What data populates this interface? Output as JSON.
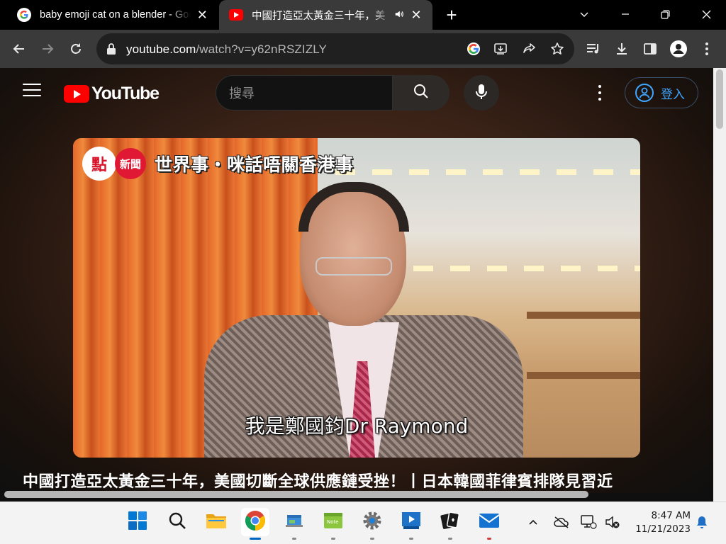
{
  "browser": {
    "tabs": [
      {
        "title": "baby emoji cat on a blender - Goo",
        "favicon": "google-icon"
      },
      {
        "title": "中國打造亞太黃金三十年，美",
        "favicon": "youtube-icon",
        "active": true
      }
    ],
    "url_host": "youtube.com",
    "url_path": "/watch?v=y62nRSZIZLY"
  },
  "youtube": {
    "logo_text": "YouTube",
    "search_placeholder": "搜尋",
    "signin_label": "登入"
  },
  "video": {
    "channel_overlay": "世界事‧咪話唔關香港事",
    "logo1_text": "點",
    "logo2_text": "新聞",
    "subtitle": "我是鄭國鈞Dr Raymond",
    "title": "中國打造亞太黃金三十年，美國切斷全球供應鏈受挫！丨日本韓國菲律賓排隊見習近"
  },
  "taskbar": {
    "time": "8:47 AM",
    "date": "11/21/2023"
  },
  "colors": {
    "yt_red": "#ff0000",
    "link_blue": "#3ea6ff",
    "win_blue": "#0067c0"
  }
}
